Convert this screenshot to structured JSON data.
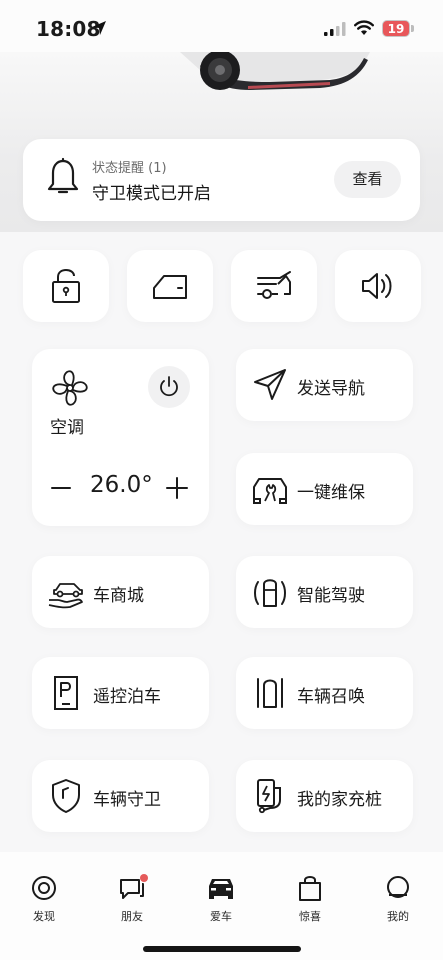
{
  "status_bar": {
    "time": "18:08",
    "battery": "19",
    "battery_color": "#e8575a"
  },
  "notice": {
    "subtitle": "状态提醒 (1)",
    "title": "守卫模式已开启",
    "view_button": "查看"
  },
  "quick_controls": [
    {
      "name": "lock",
      "icon": "unlock-icon"
    },
    {
      "name": "door",
      "icon": "car-door-icon"
    },
    {
      "name": "trunk",
      "icon": "trunk-icon"
    },
    {
      "name": "horn",
      "icon": "speaker-icon"
    }
  ],
  "ac": {
    "label": "空调",
    "temperature": "26.0°",
    "minus": "−",
    "plus": "+"
  },
  "tiles": {
    "send_nav": "发送导航",
    "maintenance": "一键维保",
    "car_store": "车商城",
    "smart_drive": "智能驾驶",
    "remote_parking": "遥控泊车",
    "summon": "车辆召唤",
    "guard": "车辆守卫",
    "charger": "我的家充桩"
  },
  "tab_bar": {
    "discover": "发现",
    "friends": "朋友",
    "my_car": "爱车",
    "surprise": "惊喜",
    "mine": "我的",
    "badge_color": "#e55a5a"
  }
}
